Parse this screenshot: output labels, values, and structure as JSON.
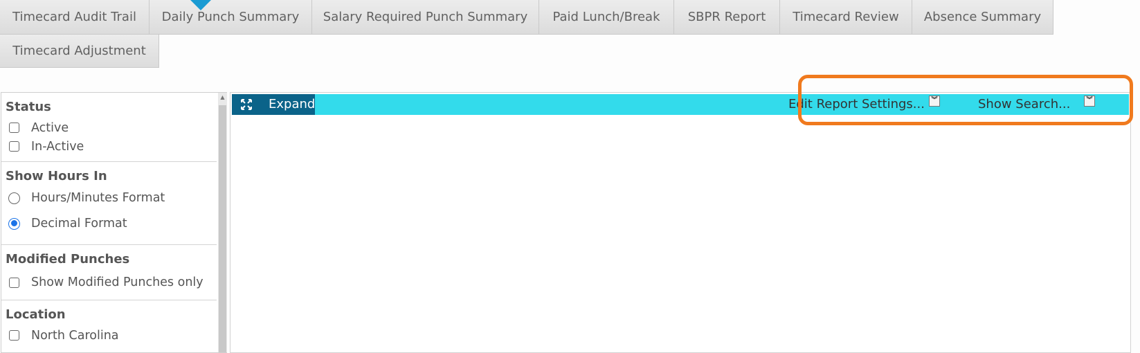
{
  "tabs": [
    {
      "label": "Timecard Audit Trail"
    },
    {
      "label": "Daily Punch Summary"
    },
    {
      "label": "Salary Required Punch Summary"
    },
    {
      "label": "Paid Lunch/Break"
    },
    {
      "label": "SBPR Report"
    },
    {
      "label": "Timecard Review"
    },
    {
      "label": "Absence Summary"
    },
    {
      "label": "Timecard Adjustment"
    }
  ],
  "filters": {
    "status": {
      "title": "Status",
      "options": [
        "Active",
        "In-Active"
      ]
    },
    "show_hours": {
      "title": "Show Hours In",
      "options": [
        "Hours/Minutes Format",
        "Decimal Format"
      ],
      "selected": "Decimal Format"
    },
    "modified_punches": {
      "title": "Modified Punches",
      "options": [
        "Show Modified Punches only"
      ]
    },
    "location": {
      "title": "Location",
      "options": [
        "North Carolina"
      ]
    }
  },
  "report_toolbar": {
    "expand_label": "Expand",
    "edit_settings_label": "Edit Report Settings...",
    "show_search_label": "Show Search..."
  },
  "colors": {
    "toolbar_bg": "#33dbeb",
    "expand_bg": "#0b6389",
    "highlight": "#f07a1e",
    "tab_marker": "#1a9bd3",
    "radio_selected": "#1a73e8"
  },
  "icons": {
    "expand": "expand-arrows-icon",
    "dropdown": "double-chevron-down-icon"
  }
}
